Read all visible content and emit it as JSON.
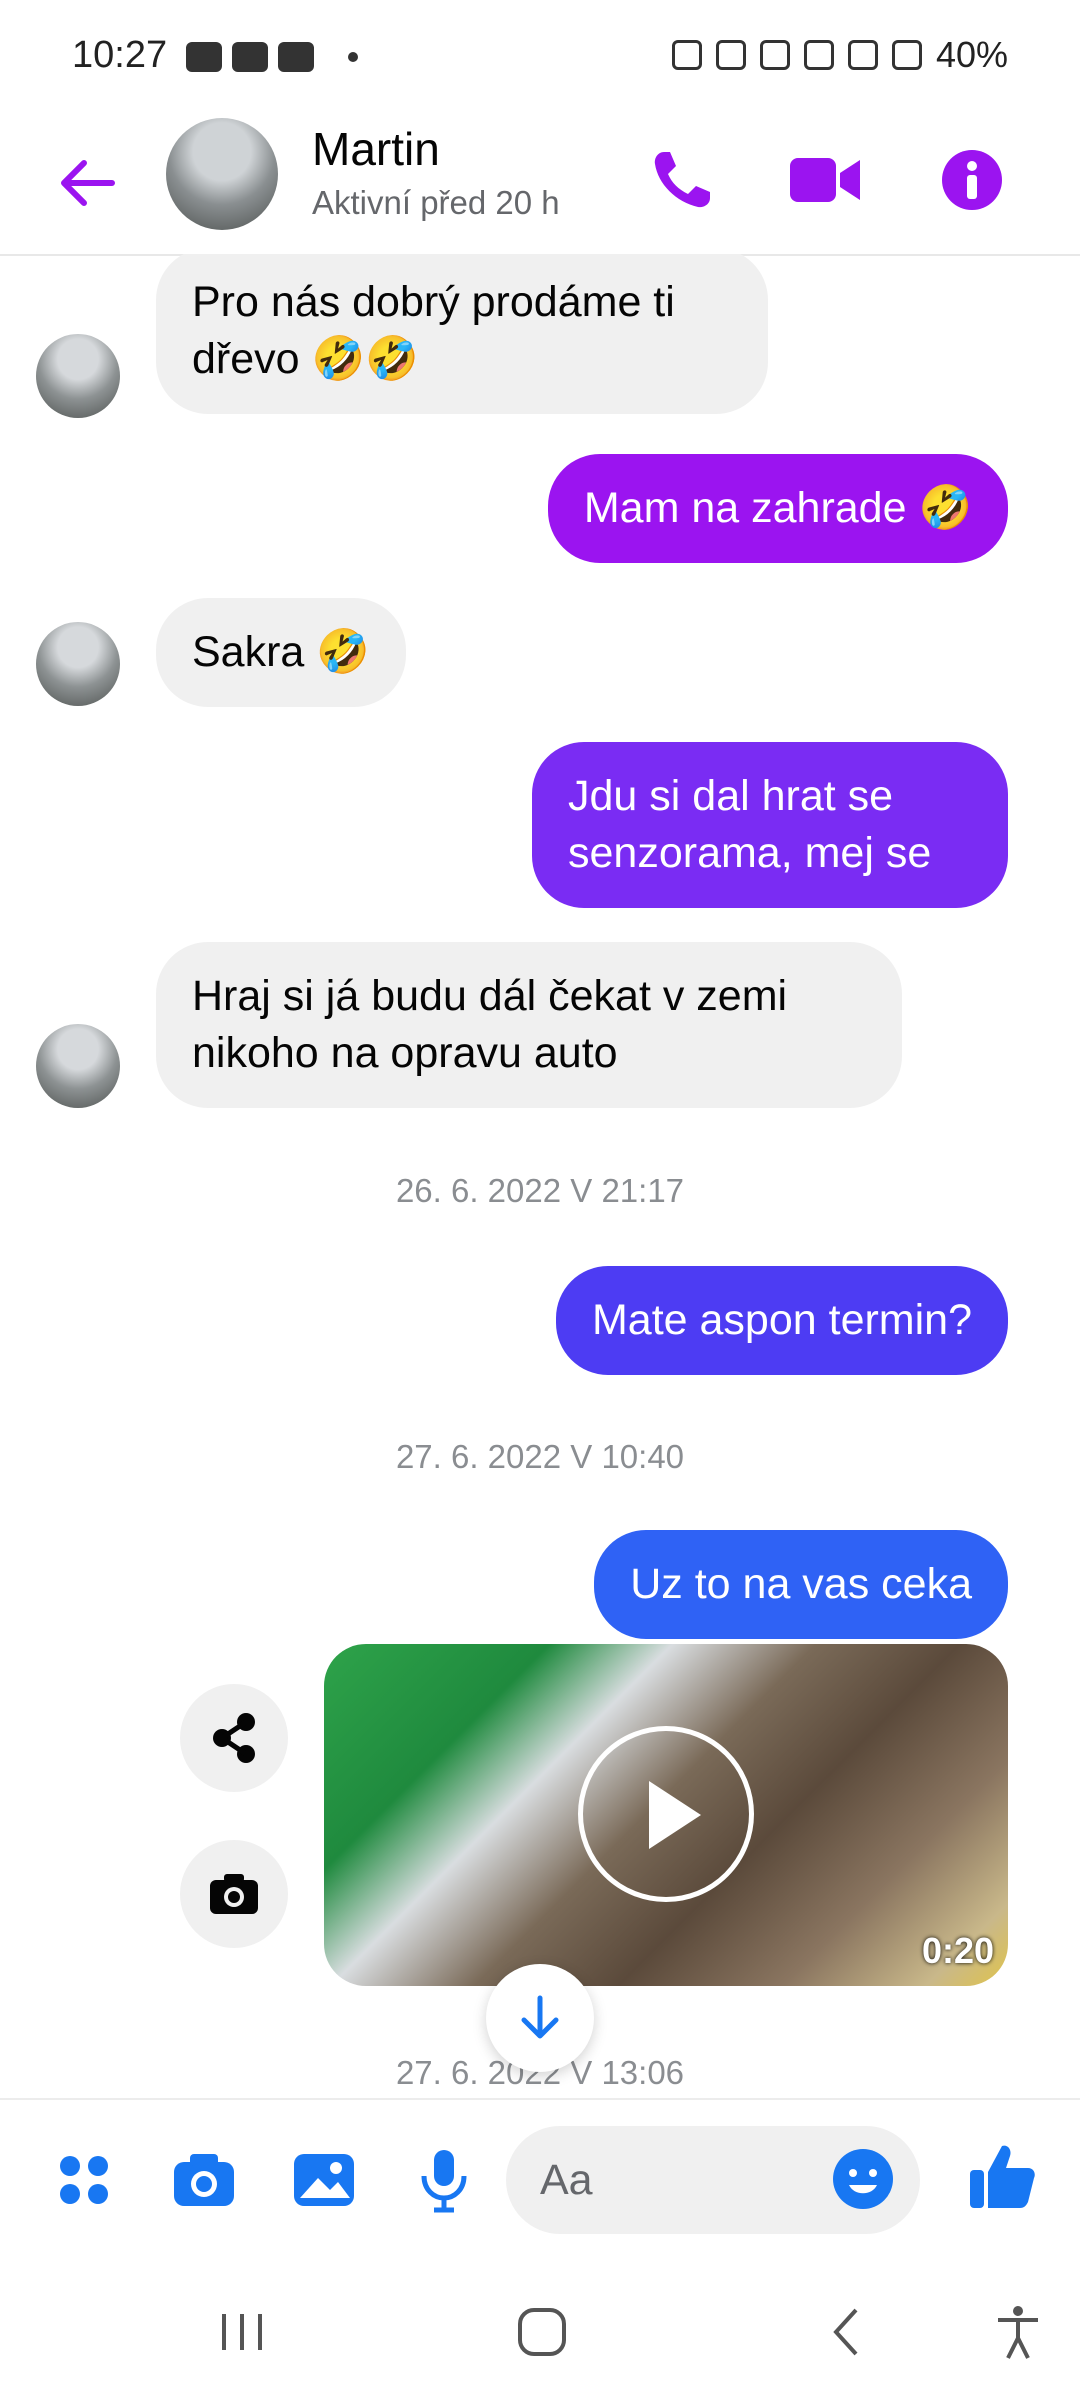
{
  "status_bar": {
    "time": "10:27",
    "battery": "40%"
  },
  "header": {
    "contact_name": "Martin",
    "contact_status": "Aktivní před 20 h"
  },
  "messages": [
    {
      "dir": "in",
      "text": "Pro nás dobrý prodáme ti dřevo 🤣🤣"
    },
    {
      "dir": "out",
      "text": "Mam na zahrade 🤣"
    },
    {
      "dir": "in",
      "text": "Sakra 🤣"
    },
    {
      "dir": "out",
      "text": "Jdu si dal hrat se senzorama, mej se"
    },
    {
      "dir": "in",
      "text": "Hraj si já budu dál čekat v zemi nikoho na opravu auto"
    },
    {
      "dir": "ts",
      "text": "26. 6. 2022 V 21:17"
    },
    {
      "dir": "out",
      "text": "Mate aspon termin?"
    },
    {
      "dir": "ts",
      "text": "27. 6. 2022 V 10:40"
    },
    {
      "dir": "out",
      "text": "Uz to na vas ceka"
    },
    {
      "dir": "video",
      "duration": "0:20"
    },
    {
      "dir": "ts",
      "text": "27. 6. 2022 V 13:06"
    }
  ],
  "composer": {
    "placeholder": "Aa"
  },
  "colors": {
    "accent": "#9b14f0",
    "out_purple": "#9b14f0",
    "out_violet": "#7a2cf3",
    "out_indigo": "#4d3cf3",
    "out_blue": "#2f62f5",
    "composer_blue": "#1877f2"
  }
}
